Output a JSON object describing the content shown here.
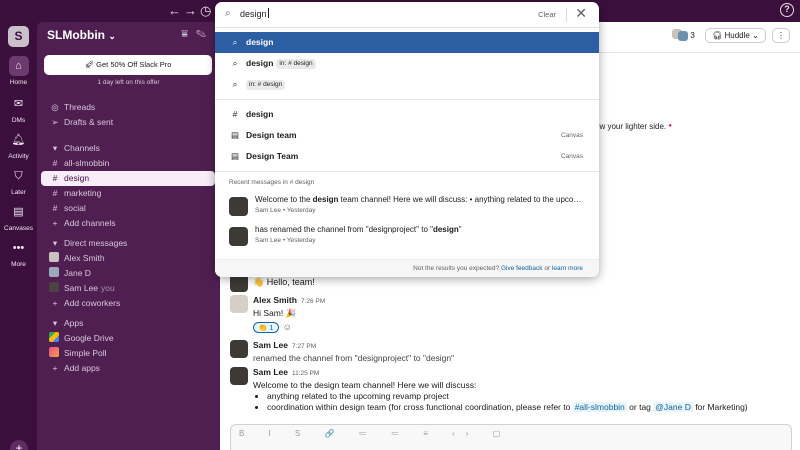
{
  "topbar": {
    "back": "←",
    "forward": "→",
    "history": "◷",
    "help": "?"
  },
  "workspace": {
    "initial": "S",
    "name": "SLMobbin",
    "caret": "⌄"
  },
  "rail": [
    {
      "icon": "home-icon",
      "glyph": "⌂",
      "label": "Home"
    },
    {
      "icon": "dms-icon",
      "glyph": "✉",
      "label": "DMs"
    },
    {
      "icon": "bell-icon",
      "glyph": "🔔︎",
      "label": "Activity"
    },
    {
      "icon": "bookmark-icon",
      "glyph": "⛉",
      "label": "Later"
    },
    {
      "icon": "canvas-icon",
      "glyph": "▤",
      "label": "Canvases"
    },
    {
      "icon": "more-icon",
      "glyph": "•••",
      "label": "More"
    }
  ],
  "sidebar": {
    "promo_label": "Get 50% Off Slack Pro",
    "promo_sub": "1 day left on this offer",
    "threads": "Threads",
    "drafts": "Drafts & sent",
    "channels_header": "Channels",
    "channels": [
      "all-slmobbin",
      "design",
      "marketing",
      "social"
    ],
    "add_channels": "Add channels",
    "dm_header": "Direct messages",
    "dms": [
      "Alex Smith",
      "Jane D",
      "Sam Lee"
    ],
    "you": "you",
    "add_coworkers": "Add coworkers",
    "apps_header": "Apps",
    "apps": [
      "Google Drive",
      "Simple Poll"
    ],
    "add_apps": "Add apps"
  },
  "header": {
    "member_count": "3",
    "huddle": "Huddle"
  },
  "channel_intro_tail": "ow your lighter side.",
  "messages": {
    "hello": "👋 Hello, team!",
    "alex": {
      "name": "Alex Smith",
      "time": "7:26 PM",
      "text": "Hi Sam! 🎉",
      "reaction": "👏 1"
    },
    "sam1": {
      "name": "Sam Lee",
      "time": "7:27 PM",
      "text": "renamed the channel from \"designproject\" to \"design\""
    },
    "sam2": {
      "name": "Sam Lee",
      "time": "11:25 PM",
      "text": "Welcome to the design team channel! Here we will discuss:",
      "bullet1": "anything related to the upcoming revamp project",
      "bullet2_pre": "coordination within design team (for cross functional coordination, please refer to ",
      "bullet2_link": "#all-slmobbin",
      "bullet2_mid": " or tag ",
      "bullet2_tag": "@Jane D",
      "bullet2_post": " for Marketing)"
    }
  },
  "composer": {
    "toolbar": "B I S 🔗 ≔ ≔ ≡ ‹› ▢"
  },
  "search": {
    "query": "design",
    "clear": "Clear",
    "close": "✕",
    "suggestions": [
      {
        "icon": "search-icon",
        "text": "design",
        "chip": ""
      },
      {
        "icon": "search-icon",
        "text": "design",
        "chip": "in: # design"
      },
      {
        "icon": "search-icon",
        "text": "",
        "chip": "in: # design"
      }
    ],
    "results": [
      {
        "icon": "hash-icon",
        "text": "design",
        "tag": ""
      },
      {
        "icon": "canvas-icon",
        "text": "Design team",
        "tag": "Canvas"
      },
      {
        "icon": "canvas-icon",
        "text": "Design Team",
        "tag": "Canvas"
      }
    ],
    "recent_header": "Recent messages in # design",
    "recent": [
      {
        "pre": "Welcome to the ",
        "bold": "design",
        "post": " team channel! Here we will discuss: • anything related to the upcomi...",
        "author": "Sam Lee",
        "when": "Yesterday"
      },
      {
        "pre": "has renamed the channel from \"designproject\" to \"",
        "bold": "design",
        "post": "\"",
        "author": "Sam Lee",
        "when": "Yesterday"
      }
    ],
    "footer_pre": "Not the results you expected? ",
    "footer_link1": "Give feedback",
    "footer_mid": " or ",
    "footer_link2": "learn more"
  }
}
